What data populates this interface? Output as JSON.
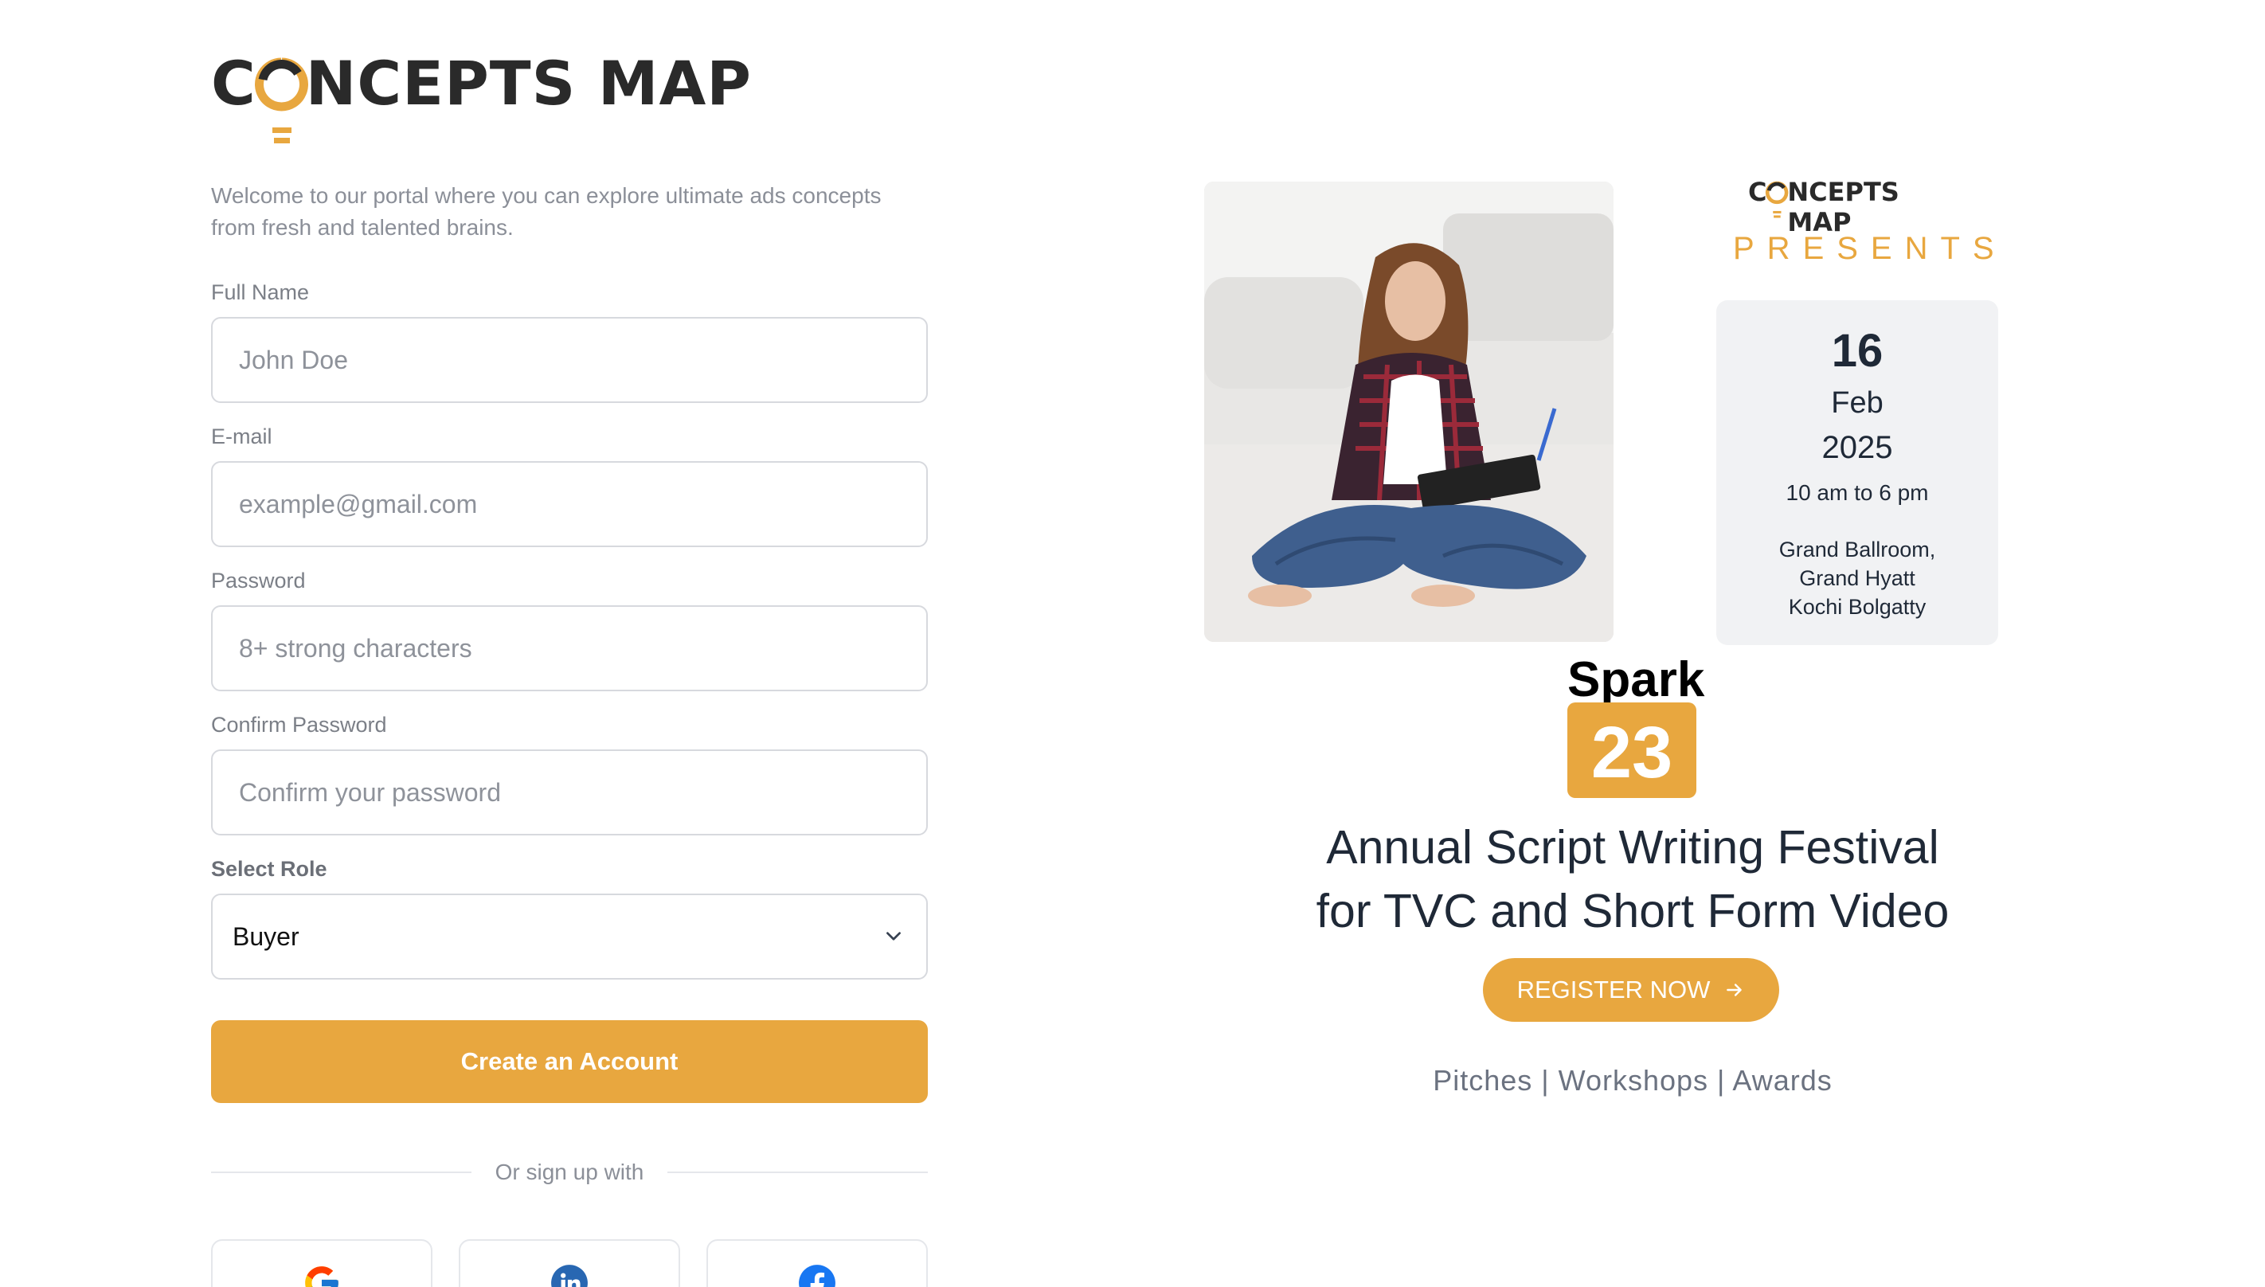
{
  "brand": {
    "name_prefix": "C",
    "name_suffix": "NCEPTS MAP",
    "accent_color": "#e8a73f",
    "text_color": "#2a2a2a"
  },
  "signup": {
    "welcome": "Welcome to our portal where you can explore ultimate ads concepts from fresh and talented brains.",
    "full_name": {
      "label": "Full Name",
      "placeholder": "John Doe"
    },
    "email": {
      "label": "E-mail",
      "placeholder": "example@gmail.com"
    },
    "password": {
      "label": "Password",
      "placeholder": "8+ strong characters"
    },
    "confirm_password": {
      "label": "Confirm Password",
      "placeholder": "Confirm your password"
    },
    "role": {
      "label": "Select Role",
      "value": "Buyer",
      "icon": "chevron-down-icon"
    },
    "create_button": "Create an Account",
    "divider_text": "Or sign up with",
    "social": [
      {
        "name": "google",
        "icon": "google-icon"
      },
      {
        "name": "linkedin",
        "icon": "linkedin-icon"
      },
      {
        "name": "facebook",
        "icon": "facebook-icon"
      }
    ]
  },
  "event": {
    "presents": "PRESENTS",
    "date": {
      "day": "16",
      "month": "Feb",
      "year": "2025"
    },
    "time": "10 am to 6 pm",
    "venue": [
      "Grand Ballroom,",
      "Grand Hyatt",
      "Kochi Bolgatty"
    ],
    "spark_word": "Spark",
    "spark_number": "23",
    "headline_line1": "Annual Script Writing Festival",
    "headline_line2": "for TVC and Short Form Video",
    "register_button": "REGISTER NOW",
    "tags": "Pitches | Workshops | Awards"
  }
}
